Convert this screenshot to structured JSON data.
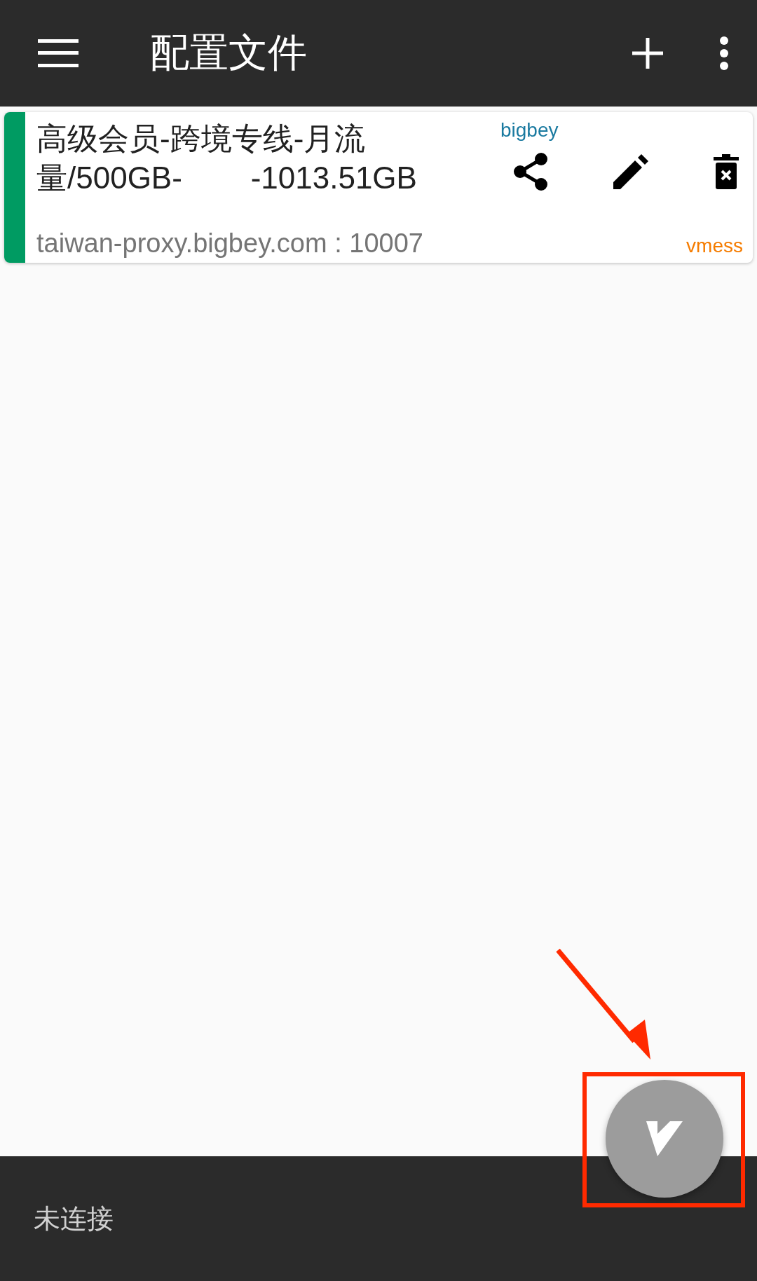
{
  "app_bar": {
    "title": "配置文件"
  },
  "profiles": [
    {
      "name": "高级会员-跨境专线-月流量/500GB-        -1013.51GB",
      "group": "bigbey",
      "address": "taiwan-proxy.bigbey.com : 10007",
      "protocol": "vmess",
      "selected": true
    }
  ],
  "fab": {
    "running": false
  },
  "status": "未连接"
}
